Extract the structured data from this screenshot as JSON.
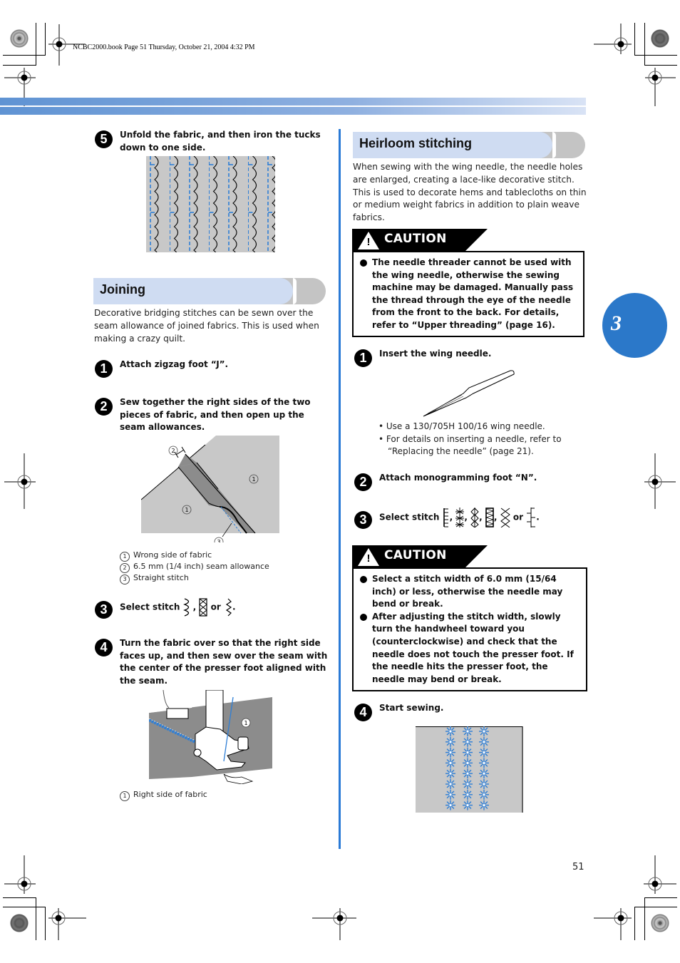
{
  "slug": "NCBC2000.book  Page 51  Thursday, October 21, 2004  4:32 PM",
  "chapter_tab": "3",
  "page_number": "51",
  "left_column": {
    "step5": {
      "number": "5",
      "text": "Unfold the fabric, and then iron the tucks down to one side."
    },
    "joining": {
      "heading": "Joining",
      "intro": "Decorative bridging stitches can be sewn over the seam allowance of joined fabrics. This is used when making a crazy quilt.",
      "steps": [
        {
          "number": "1",
          "text": "Attach zigzag foot “J”."
        },
        {
          "number": "2",
          "text": "Sew together the right sides of the two pieces of fabric, and then open up the seam allowances."
        },
        {
          "number": "3",
          "prefix": "Select stitch",
          "sep1": ",",
          "or": "or",
          "end": "."
        },
        {
          "number": "4",
          "text": "Turn the fabric over so that the right side faces up, and then sew over the seam with the center of the presser foot aligned with the seam."
        }
      ],
      "seam_figure_legend": [
        {
          "num": "1",
          "text": "Wrong side of fabric"
        },
        {
          "num": "2",
          "text": "6.5 mm (1/4 inch) seam allowance"
        },
        {
          "num": "3",
          "text": "Straight stitch"
        }
      ],
      "seam_callouts": [
        "1",
        "1",
        "2",
        "3"
      ],
      "foot_figure_legend": [
        {
          "num": "1",
          "text": "Right side of fabric"
        }
      ],
      "foot_callout": "1",
      "stitch_icons": [
        "zigzag-curve-stitch-icon",
        "cross-box-stitch-icon",
        "zigzag-stitch-icon"
      ]
    }
  },
  "right_column": {
    "heirloom": {
      "heading": "Heirloom stitching",
      "intro": "When sewing with the wing needle, the needle holes are enlarged, creating a lace-like decorative stitch. This is used to decorate hems and tablecloths on thin or medium weight fabrics in addition to plain weave fabrics.",
      "caution1": {
        "label": "CAUTION",
        "items": [
          "The needle threader cannot be used with the wing needle, otherwise the sewing machine may be damaged. Manually pass the thread through the eye of the needle from the front to the back. For details, refer to “Upper threading” (page 16)."
        ]
      },
      "steps": [
        {
          "number": "1",
          "text": "Insert the wing needle."
        },
        {
          "number": "2",
          "text": "Attach monogramming foot “N”."
        },
        {
          "number": "3",
          "prefix": "Select stitch",
          "sep": ",",
          "or": "or",
          "end": "."
        },
        {
          "number": "4",
          "text": "Start sewing."
        }
      ],
      "needle_bullets": [
        "• Use a 130/705H 100/16 wing needle.",
        "• For details on inserting a needle, refer to “Replacing the needle” (page 21)."
      ],
      "stitch_icons": [
        "ladder-stitch-icon",
        "star-stitch-icon",
        "diamond-stitch-icon",
        "box-zigzag-stitch-icon",
        "cross-diamond-stitch-icon",
        "branch-stitch-icon"
      ],
      "caution2": {
        "label": "CAUTION",
        "items": [
          "Select a stitch width of 6.0 mm (15/64 inch) or less, otherwise the needle may bend or break.",
          "After adjusting the stitch width, slowly turn the handwheel toward you (counterclockwise) and check that the needle does not touch the presser foot. If the needle hits the presser foot, the needle may bend or break."
        ]
      }
    }
  },
  "colors": {
    "accent_blue": "#2a7ad6",
    "chapter_blue": "#2b78c9",
    "heading_fill": "#cfdcf2",
    "fabric_gray": "#c8c8c8",
    "stitch_blue": "#2f7fd6"
  }
}
